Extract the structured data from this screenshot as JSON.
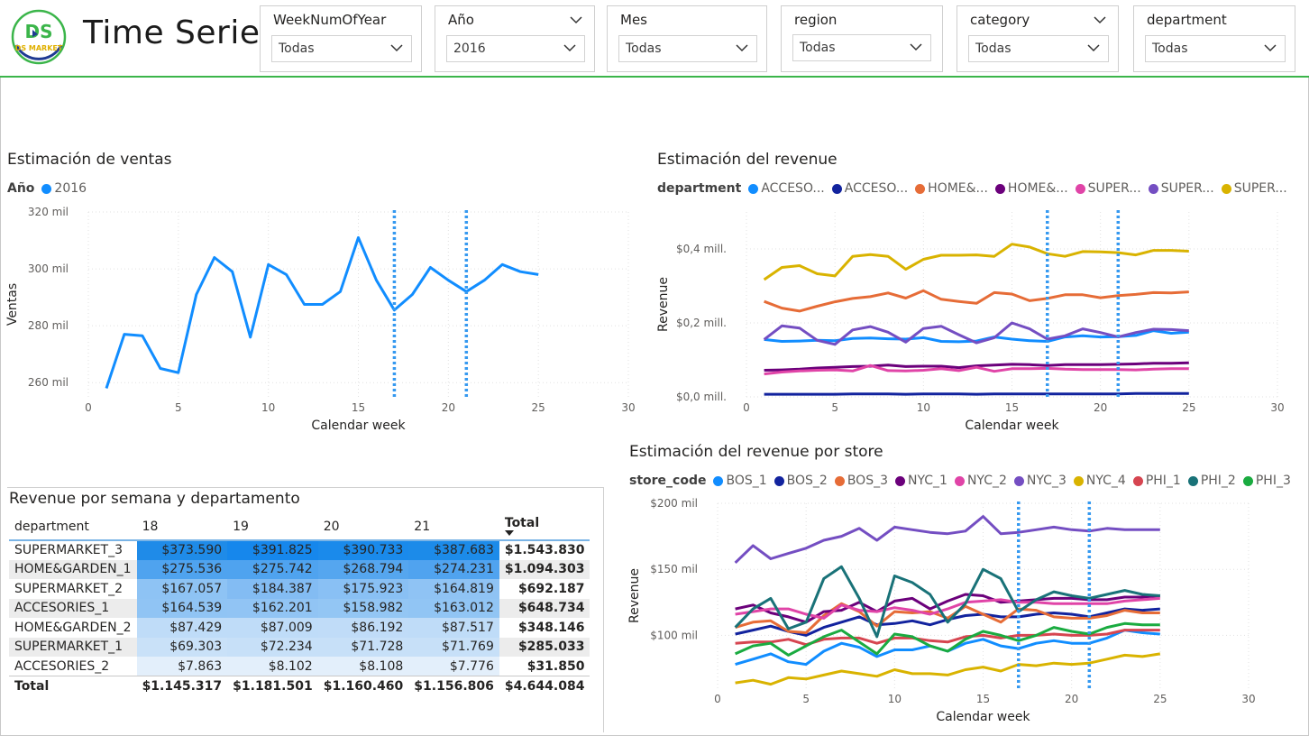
{
  "header": {
    "title": "Time Series",
    "logo_text": "DS MARKET",
    "slicers": [
      {
        "title": "WeekNumOfYear",
        "value": "Todas"
      },
      {
        "title": "Año",
        "value": "2016"
      },
      {
        "title": "Mes",
        "value": "Todas"
      },
      {
        "title": "region",
        "value": "Todas"
      },
      {
        "title": "category",
        "value": "Todas"
      },
      {
        "title": "department",
        "value": "Todas"
      }
    ]
  },
  "colors": {
    "accent_green": "#3bb54a",
    "blue": "#118dff",
    "dark_blue": "#12239e",
    "orange": "#e66c37",
    "purple_dark": "#6b007b",
    "pink": "#e044a7",
    "purple": "#744ec2",
    "gold": "#d9b300",
    "red": "#d64550",
    "teal": "#197278",
    "green": "#1aab40"
  },
  "chart_data": [
    {
      "id": "ventas",
      "type": "line",
      "title": "Estimación de ventas",
      "legend_title": "Año",
      "xlabel": "Calendar week",
      "ylabel": "Ventas",
      "xlim": [
        0,
        30
      ],
      "ylim": [
        255,
        320
      ],
      "x_ticks": [
        0,
        5,
        10,
        15,
        20,
        25,
        30
      ],
      "y_ticks": [
        260,
        280,
        300,
        320
      ],
      "y_tick_labels": [
        "260 mil",
        "280 mil",
        "300 mil",
        "320 mil"
      ],
      "reference_lines_x": [
        17,
        21
      ],
      "grid": true,
      "legend_position": "top-left",
      "series": [
        {
          "name": "2016",
          "color": "#118dff",
          "x": [
            1,
            2,
            3,
            4,
            5,
            6,
            7,
            8,
            9,
            10,
            11,
            12,
            13,
            14,
            15,
            16,
            17,
            18,
            19,
            20,
            21,
            22,
            23,
            24,
            25
          ],
          "values": [
            258,
            277,
            276.5,
            265,
            263.5,
            291,
            304,
            299,
            276,
            301.5,
            298,
            287.5,
            287.5,
            292,
            311,
            296,
            285.5,
            291,
            300.5,
            296,
            292,
            296,
            301.5,
            299,
            298
          ]
        }
      ]
    },
    {
      "id": "revenue",
      "type": "line",
      "title": "Estimación del revenue",
      "legend_title": "department",
      "xlabel": "Calendar week",
      "ylabel": "Revenue",
      "xlim": [
        0,
        30
      ],
      "ylim": [
        0,
        0.5
      ],
      "x_ticks": [
        0,
        5,
        10,
        15,
        20,
        25,
        30
      ],
      "y_ticks": [
        0,
        0.2,
        0.4
      ],
      "y_tick_labels": [
        "$0,0 mill.",
        "$0,2 mill.",
        "$0,4 mill."
      ],
      "reference_lines_x": [
        17,
        21
      ],
      "grid": true,
      "legend_position": "top-left",
      "series": [
        {
          "name": "ACCESO...",
          "color": "#118dff",
          "values": [
            0.155,
            0.15,
            0.151,
            0.153,
            0.152,
            0.158,
            0.159,
            0.157,
            0.156,
            0.16,
            0.15,
            0.149,
            0.151,
            0.162,
            0.156,
            0.152,
            0.15,
            0.162,
            0.165,
            0.162,
            0.163,
            0.166,
            0.179,
            0.172,
            0.175
          ]
        },
        {
          "name": "ACCESO...",
          "color": "#12239e",
          "values": [
            0.007,
            0.007,
            0.007,
            0.007,
            0.007,
            0.008,
            0.008,
            0.008,
            0.007,
            0.008,
            0.008,
            0.008,
            0.007,
            0.008,
            0.008,
            0.008,
            0.008,
            0.008,
            0.008,
            0.008,
            0.008,
            0.009,
            0.009,
            0.009,
            0.009
          ]
        },
        {
          "name": "HOME&...",
          "color": "#e66c37",
          "values": [
            0.258,
            0.24,
            0.232,
            0.245,
            0.257,
            0.266,
            0.271,
            0.281,
            0.267,
            0.287,
            0.264,
            0.258,
            0.253,
            0.282,
            0.278,
            0.26,
            0.266,
            0.276,
            0.276,
            0.268,
            0.274,
            0.277,
            0.282,
            0.281,
            0.284
          ]
        },
        {
          "name": "HOME&...",
          "color": "#6b007b",
          "values": [
            0.072,
            0.073,
            0.075,
            0.078,
            0.08,
            0.082,
            0.083,
            0.086,
            0.082,
            0.083,
            0.083,
            0.079,
            0.084,
            0.086,
            0.088,
            0.087,
            0.085,
            0.087,
            0.087,
            0.087,
            0.088,
            0.089,
            0.091,
            0.091,
            0.092
          ]
        },
        {
          "name": "SUPER...",
          "color": "#e044a7",
          "values": [
            0.062,
            0.067,
            0.07,
            0.072,
            0.073,
            0.07,
            0.085,
            0.071,
            0.07,
            0.072,
            0.076,
            0.071,
            0.08,
            0.069,
            0.076,
            0.076,
            0.077,
            0.075,
            0.074,
            0.074,
            0.074,
            0.073,
            0.075,
            0.076,
            0.076
          ]
        },
        {
          "name": "SUPER...",
          "color": "#744ec2",
          "values": [
            0.155,
            0.192,
            0.186,
            0.153,
            0.142,
            0.181,
            0.19,
            0.175,
            0.148,
            0.185,
            0.191,
            0.168,
            0.146,
            0.16,
            0.2,
            0.184,
            0.156,
            0.165,
            0.184,
            0.174,
            0.162,
            0.174,
            0.183,
            0.182,
            0.179
          ]
        },
        {
          "name": "SUPER...",
          "color": "#d9b300",
          "values": [
            0.317,
            0.35,
            0.355,
            0.333,
            0.327,
            0.38,
            0.385,
            0.38,
            0.345,
            0.372,
            0.383,
            0.383,
            0.384,
            0.38,
            0.413,
            0.405,
            0.387,
            0.38,
            0.393,
            0.392,
            0.39,
            0.384,
            0.396,
            0.396,
            0.394
          ]
        }
      ]
    },
    {
      "id": "store",
      "type": "line",
      "title": "Estimación del revenue por store",
      "legend_title": "store_code",
      "xlabel": "Calendar week",
      "ylabel": "Revenue",
      "xlim": [
        0,
        30
      ],
      "ylim": [
        60,
        200
      ],
      "x_ticks": [
        0,
        5,
        10,
        15,
        20,
        25,
        30
      ],
      "y_ticks": [
        100,
        150,
        200
      ],
      "y_tick_labels": [
        "$100 mil",
        "$150 mil",
        "$200 mil"
      ],
      "reference_lines_x": [
        17,
        21
      ],
      "grid": true,
      "legend_position": "top-left",
      "series": [
        {
          "name": "BOS_1",
          "color": "#118dff",
          "values": [
            78,
            82,
            86,
            80,
            78,
            88,
            94,
            91,
            84,
            89,
            89,
            92,
            88,
            94,
            97,
            92,
            90,
            94,
            96,
            94,
            94,
            98,
            104,
            102,
            101
          ]
        },
        {
          "name": "BOS_2",
          "color": "#12239e",
          "values": [
            101,
            104,
            107,
            103,
            100,
            106,
            110,
            114,
            108,
            109,
            111,
            108,
            112,
            115,
            116,
            114,
            114,
            116,
            117,
            116,
            114,
            117,
            120,
            119,
            120
          ]
        },
        {
          "name": "BOS_3",
          "color": "#e66c37",
          "values": [
            106,
            110,
            111,
            103,
            102,
            115,
            124,
            118,
            107,
            118,
            117,
            118,
            113,
            122,
            116,
            110,
            120,
            119,
            114,
            113,
            113,
            115,
            119,
            117,
            117
          ]
        },
        {
          "name": "NYC_1",
          "color": "#6b007b",
          "values": [
            120,
            123,
            117,
            114,
            110,
            118,
            119,
            125,
            118,
            126,
            128,
            120,
            126,
            131,
            130,
            125,
            126,
            127,
            128,
            128,
            127,
            127,
            129,
            129,
            130
          ]
        },
        {
          "name": "NYC_2",
          "color": "#e044a7",
          "values": [
            116,
            118,
            120,
            120,
            116,
            113,
            123,
            119,
            118,
            121,
            119,
            116,
            120,
            125,
            126,
            127,
            125,
            125,
            124,
            124,
            124,
            124,
            126,
            127,
            128
          ]
        },
        {
          "name": "NYC_3",
          "color": "#744ec2",
          "values": [
            155,
            168,
            158,
            162,
            166,
            172,
            175,
            181,
            172,
            182,
            180,
            178,
            177,
            179,
            190,
            177,
            178,
            180,
            182,
            180,
            179,
            181,
            180,
            180,
            180
          ]
        },
        {
          "name": "NYC_4",
          "color": "#d9b300",
          "values": [
            64,
            66,
            63,
            68,
            67,
            70,
            73,
            71,
            69,
            74,
            71,
            71,
            70,
            74,
            76,
            73,
            78,
            77,
            79,
            78,
            79,
            82,
            85,
            84,
            86
          ]
        },
        {
          "name": "PHI_1",
          "color": "#d64550",
          "values": [
            94,
            95,
            95,
            97,
            93,
            97,
            98,
            98,
            94,
            98,
            98,
            96,
            95,
            99,
            100,
            98,
            100,
            100,
            101,
            100,
            100,
            101,
            104,
            104,
            104
          ]
        },
        {
          "name": "PHI_2",
          "color": "#197278",
          "values": [
            106,
            120,
            128,
            105,
            110,
            143,
            152,
            128,
            99,
            145,
            140,
            131,
            110,
            124,
            150,
            143,
            118,
            127,
            133,
            130,
            128,
            131,
            134,
            131,
            130
          ]
        },
        {
          "name": "PHI_3",
          "color": "#1aab40",
          "values": [
            86,
            92,
            94,
            85,
            92,
            99,
            104,
            95,
            86,
            101,
            99,
            92,
            88,
            97,
            103,
            100,
            96,
            100,
            106,
            103,
            101,
            106,
            109,
            108,
            108
          ]
        }
      ]
    }
  ],
  "matrix": {
    "title": "Revenue por semana y departamento",
    "col_header": "department",
    "weeks": [
      "18",
      "19",
      "20",
      "21"
    ],
    "total_label": "Total",
    "rows": [
      {
        "dept": "SUPERMARKET_3",
        "vals": [
          "$373.590",
          "$391.825",
          "$390.733",
          "$387.683"
        ],
        "total": "$1.543.830"
      },
      {
        "dept": "HOME&GARDEN_1",
        "vals": [
          "$275.536",
          "$275.742",
          "$268.794",
          "$274.231"
        ],
        "total": "$1.094.303"
      },
      {
        "dept": "SUPERMARKET_2",
        "vals": [
          "$167.057",
          "$184.387",
          "$175.923",
          "$164.819"
        ],
        "total": "$692.187"
      },
      {
        "dept": "ACCESORIES_1",
        "vals": [
          "$164.539",
          "$162.201",
          "$158.982",
          "$163.012"
        ],
        "total": "$648.734"
      },
      {
        "dept": "HOME&GARDEN_2",
        "vals": [
          "$87.429",
          "$87.009",
          "$86.192",
          "$87.517"
        ],
        "total": "$348.146"
      },
      {
        "dept": "SUPERMARKET_1",
        "vals": [
          "$69.303",
          "$72.234",
          "$71.728",
          "$71.769"
        ],
        "total": "$285.033"
      },
      {
        "dept": "ACCESORIES_2",
        "vals": [
          "$7.863",
          "$8.102",
          "$8.108",
          "$7.776"
        ],
        "total": "$31.850"
      }
    ],
    "totals": {
      "label": "Total",
      "vals": [
        "$1.145.317",
        "$1.181.501",
        "$1.160.460",
        "$1.156.806"
      ],
      "grand": "$4.644.084"
    }
  }
}
